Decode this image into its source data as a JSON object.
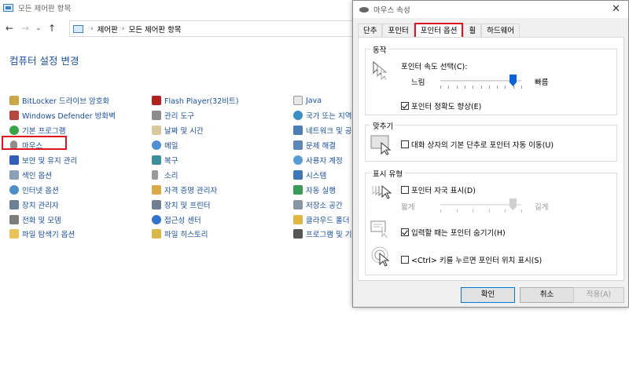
{
  "control_panel": {
    "window_title": "모든 제어판 항목",
    "breadcrumb": [
      "제어판",
      "모든 제어판 항목"
    ],
    "heading": "컴퓨터 설정 변경",
    "columns": [
      [
        "BitLocker 드라이브 암호화",
        "Windows Defender 방화벽",
        "기본 프로그램",
        "마우스",
        "보안 및 유지 관리",
        "색인 옵션",
        "인터넷 옵션",
        "장치 관리자",
        "전화 및 모뎀",
        "파일 탐색기 옵션"
      ],
      [
        "Flash Player(32비트)",
        "관리 도구",
        "날짜 및 시간",
        "메일",
        "복구",
        "소리",
        "자격 증명 관리자",
        "장치 및 프린터",
        "접근성 센터",
        "파일 히스토리"
      ],
      [
        "Java",
        "국가 또는 지역",
        "네트워크 및 공",
        "문제 해결",
        "사용자 계정",
        "시스템",
        "자동 실행",
        "저장소 공간",
        "클라우드 폴더",
        "프로그램 및 기"
      ]
    ]
  },
  "dialog": {
    "title": "마우스 속성",
    "tabs": [
      "단추",
      "포인터",
      "포인터 옵션",
      "휠",
      "하드웨어"
    ],
    "active_tab": "포인터 옵션",
    "motion": {
      "group_label": "동작",
      "speed_label": "포인터 속도 선택(C):",
      "slow": "느림",
      "fast": "빠름",
      "speed_value_fraction": 0.9,
      "precision_label": "포인터 정확도 향상(E)",
      "precision_checked": true
    },
    "snap": {
      "group_label": "맞추기",
      "snap_label": "대화 상자의 기본 단추로 포인터 자동 이동(U)",
      "snap_checked": false
    },
    "visibility": {
      "group_label": "표시 유형",
      "trails_label": "포인터 자국 표시(D)",
      "trails_checked": false,
      "short": "짧게",
      "long": "길게",
      "trails_value_fraction": 0.9,
      "hide_label": "입력할 때는 포인터 숨기기(H)",
      "hide_checked": true,
      "ctrl_label": "<Ctrl> 키를 누르면 포인터 위치 표시(S)",
      "ctrl_checked": false
    },
    "buttons": {
      "ok": "확인",
      "cancel": "취소",
      "apply": "적용(A)"
    }
  },
  "colors": {
    "link": "#1a4ea0",
    "heading": "#1e4fa5",
    "highlight": "#e0141e",
    "slider_thumb": "#0a64d6"
  }
}
